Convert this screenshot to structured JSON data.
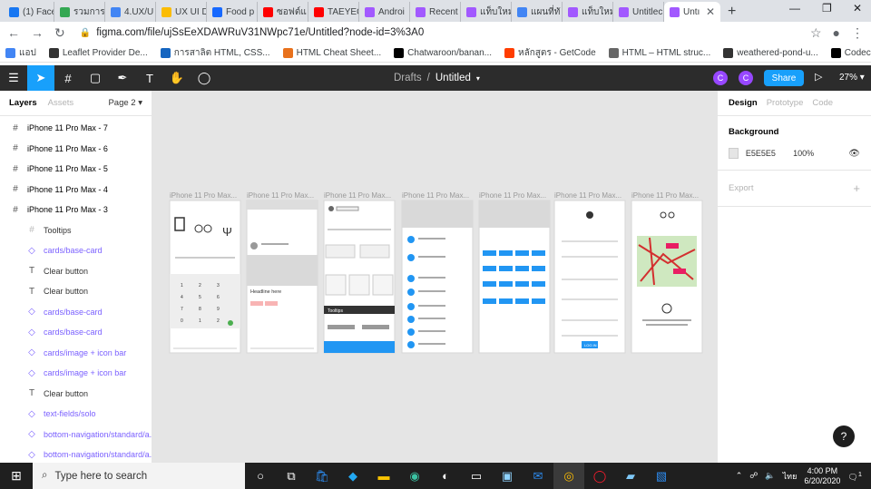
{
  "browser": {
    "tabs": [
      {
        "label": "(1) Face",
        "color": "#1877f2"
      },
      {
        "label": "รวมการ",
        "color": "#34a853"
      },
      {
        "label": "4.UX/U",
        "color": "#4285f4"
      },
      {
        "label": "UX UI D",
        "color": "#fbbc04"
      },
      {
        "label": "Food p",
        "color": "#1769ff"
      },
      {
        "label": "ซอฟต์แ",
        "color": "#ff0000"
      },
      {
        "label": "TAEYEC",
        "color": "#ff0000"
      },
      {
        "label": "Androi",
        "color": "#a259ff"
      },
      {
        "label": "Recent",
        "color": "#a259ff"
      },
      {
        "label": "แท็บใหม่",
        "color": "#a259ff"
      },
      {
        "label": "แผนที่ทั",
        "color": "#4285f4"
      },
      {
        "label": "แท็บใหม่",
        "color": "#a259ff"
      },
      {
        "label": "Untitlec",
        "color": "#a259ff"
      },
      {
        "label": "Untı",
        "color": "#a259ff"
      }
    ],
    "new_tab": "+",
    "url": "figma.com/file/ujSsEeXDAWRuV31NWpc71e/Untitled?node-id=3%3A0",
    "bookmarks": [
      "แอป",
      "Leaflet Provider De...",
      "การสาลิต HTML, CSS...",
      "HTML Cheat Sheet...",
      "Chatwaroon/banan...",
      "หลักสูตร - GetCode",
      "HTML – HTML struc...",
      "weathered-pond-u...",
      "Codecamp Practice..."
    ]
  },
  "figma": {
    "drafts": "Drafts",
    "sep": "/",
    "file_name": "Untitled",
    "avatar_letter": "C",
    "share_label": "Share",
    "zoom_label": "27%"
  },
  "left_panel": {
    "tab_layers": "Layers",
    "tab_assets": "Assets",
    "page_label": "Page 2",
    "layers": [
      {
        "name": "iPhone 11 Pro Max - 7",
        "type": "frame",
        "indent": 0
      },
      {
        "name": "iPhone 11 Pro Max - 6",
        "type": "frame",
        "indent": 0
      },
      {
        "name": "iPhone 11 Pro Max - 5",
        "type": "frame",
        "indent": 0
      },
      {
        "name": "iPhone 11 Pro Max - 4",
        "type": "frame",
        "indent": 0
      },
      {
        "name": "iPhone 11 Pro Max - 3",
        "type": "frame",
        "indent": 0
      },
      {
        "name": "Tooltips",
        "type": "frame",
        "indent": 1
      },
      {
        "name": "cards/base-card",
        "type": "component",
        "indent": 1
      },
      {
        "name": "Clear button",
        "type": "text",
        "indent": 1
      },
      {
        "name": "Clear button",
        "type": "text",
        "indent": 1
      },
      {
        "name": "cards/base-card",
        "type": "component",
        "indent": 1
      },
      {
        "name": "cards/base-card",
        "type": "component",
        "indent": 1
      },
      {
        "name": "cards/image + icon bar",
        "type": "component",
        "indent": 1
      },
      {
        "name": "cards/image + icon bar",
        "type": "component",
        "indent": 1
      },
      {
        "name": "Clear button",
        "type": "text",
        "indent": 1
      },
      {
        "name": "text-fields/solo",
        "type": "component",
        "indent": 1
      },
      {
        "name": "bottom-navigation/standard/a...",
        "type": "component",
        "indent": 1
      },
      {
        "name": "bottom-navigation/standard/a...",
        "type": "component",
        "indent": 1
      }
    ]
  },
  "canvas": {
    "frames": [
      {
        "label": "iPhone 11 Pro Max..."
      },
      {
        "label": "iPhone 11 Pro Max..."
      },
      {
        "label": "iPhone 11 Pro Max..."
      },
      {
        "label": "iPhone 11 Pro Max..."
      },
      {
        "label": "iPhone 11 Pro Max..."
      },
      {
        "label": "iPhone 11 Pro Max..."
      },
      {
        "label": "iPhone 11 Pro Max..."
      }
    ],
    "frame2_heading": "Headline here",
    "frame3_tooltip": "Tooltips",
    "frame6_button": "LOG IN"
  },
  "right_panel": {
    "tab_design": "Design",
    "tab_prototype": "Prototype",
    "tab_code": "Code",
    "background_title": "Background",
    "bg_hex": "E5E5E5",
    "bg_opacity": "100%",
    "export_title": "Export",
    "export_plus": "+"
  },
  "help_label": "?",
  "taskbar": {
    "search_placeholder": "Type here to search",
    "time": "4:00 PM",
    "date": "6/20/2020",
    "lang": "ไทย",
    "notif_count": "1"
  },
  "colors": {
    "figma_blue": "#18a0fb",
    "figma_dark": "#2c2c2c",
    "canvas_bg": "#e5e5e5",
    "avatar": "#9747ff"
  }
}
